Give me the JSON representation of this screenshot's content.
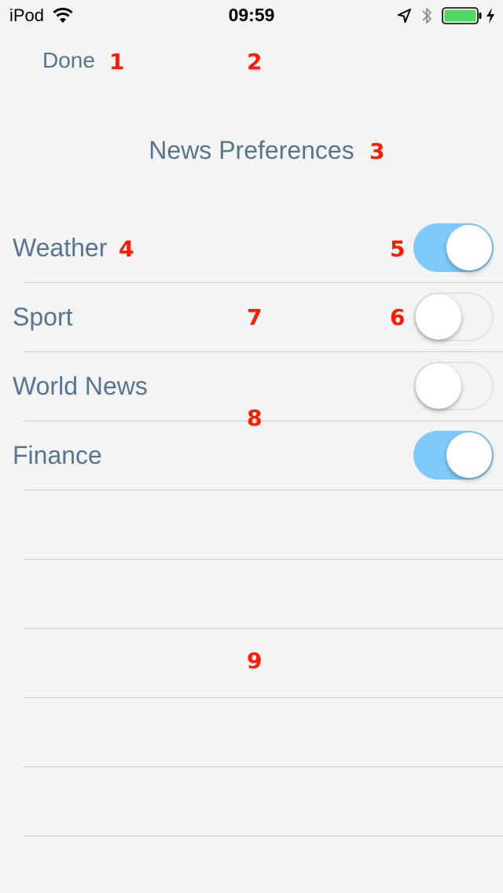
{
  "status_bar": {
    "carrier": "iPod",
    "time": "09:59",
    "battery_color": "#4cd964"
  },
  "nav": {
    "done_label": "Done",
    "title": "News Preferences"
  },
  "preferences": [
    {
      "label": "Weather",
      "enabled": true
    },
    {
      "label": "Sport",
      "enabled": false
    },
    {
      "label": "World News",
      "enabled": false
    },
    {
      "label": "Finance",
      "enabled": true
    },
    {
      "label": "",
      "enabled": null
    },
    {
      "label": "",
      "enabled": null
    },
    {
      "label": "",
      "enabled": null
    },
    {
      "label": "",
      "enabled": null
    },
    {
      "label": "",
      "enabled": null
    }
  ],
  "markers": [
    "1",
    "2",
    "3",
    "4",
    "5",
    "6",
    "7",
    "8",
    "9"
  ],
  "colors": {
    "background": "#f4f4f4",
    "text": "#557593",
    "toggle_on": "#7ecbfb",
    "separator": "#cfcfcf",
    "marker": "#ff1a00"
  }
}
